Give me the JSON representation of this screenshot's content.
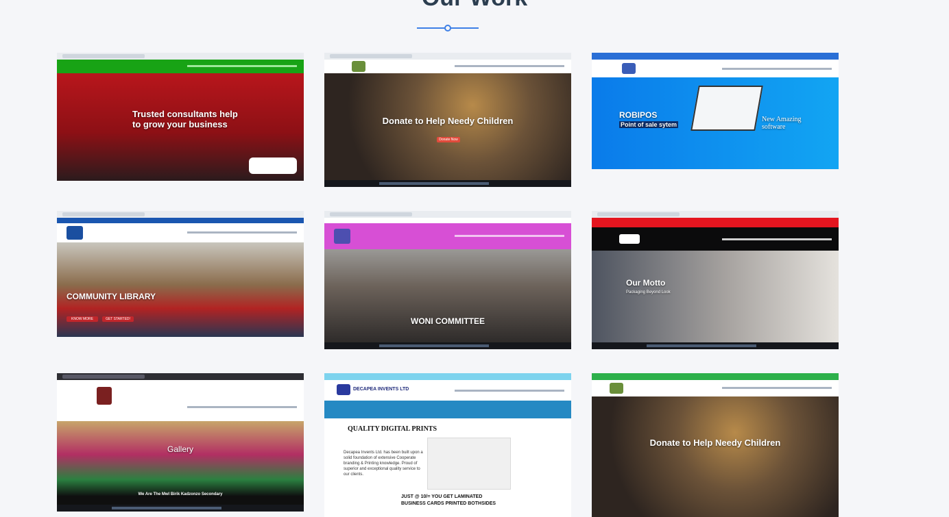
{
  "section": {
    "title": "Our Work"
  },
  "projects": [
    {
      "hero_title": "Trusted consultants help to grow your business"
    },
    {
      "hero_title": "Donate to Help Needy Children",
      "button": "Donate Now"
    },
    {
      "hero_title": "ROBIPOS",
      "hero_sub": "Point of sale sytem",
      "hero_side": "New Amazing software"
    },
    {
      "hero_title": "COMMUNITY LIBRARY",
      "btn1": "KNOW MORE",
      "btn2": "GET STARTED!"
    },
    {
      "hero_title": "WONI COMMITTEE"
    },
    {
      "hero_title": "Our Motto",
      "hero_sub": "Packaging Beyond Look"
    },
    {
      "hero_title": "Gallery",
      "caption": "We Are The Mwl Birik Kadzonzo Secondary"
    },
    {
      "brand": "DECAPEA INVENTS LTD",
      "hero_title": "QUALITY DIGITAL PRINTS",
      "body": "Decapea Invents Ltd. has been built upon a solid foundation of extensive Cooperate branding & Printing knowledge. Proud of superior and exceptional quality service to our clients.",
      "promo": "JUST @ 10/= YOU GET LAMINATED BUSINESS CARDS PRINTED BOTHSIDES"
    },
    {
      "hero_title": "Donate to Help Needy Children"
    }
  ]
}
